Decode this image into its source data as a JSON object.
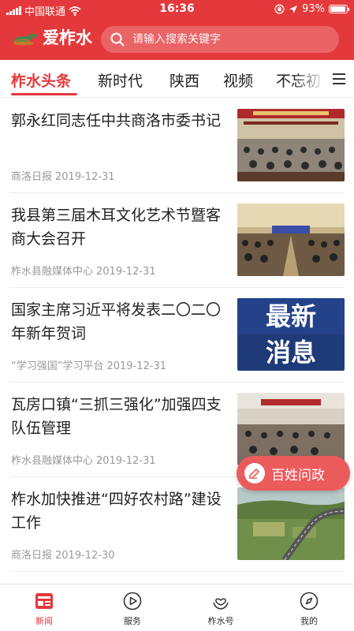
{
  "status_bar": {
    "carrier": "中国联通",
    "time": "16:36",
    "battery": "93%",
    "battery_level": 0.93
  },
  "header": {
    "app_name": "爱柞水",
    "search_placeholder": "请输入搜索关键字"
  },
  "tabs": [
    {
      "label": "柞水头条",
      "active": true
    },
    {
      "label": "新时代"
    },
    {
      "label": "陕西"
    },
    {
      "label": "视频"
    },
    {
      "label": "不忘初"
    }
  ],
  "news": [
    {
      "title": "郭永红同志任中共商洛市委书记",
      "source": "商洛日报",
      "date": "2019-12-31"
    },
    {
      "title": "我县第三届木耳文化艺术节暨客商大会召开",
      "source": "柞水县融媒体中心",
      "date": "2019-12-31"
    },
    {
      "title": "国家主席习近平将发表二〇二〇年新年贺词",
      "source": "“学习强国”学习平台",
      "date": "2019-12-31",
      "image_text_1": "最新",
      "image_text_2": "消息"
    },
    {
      "title": "瓦房口镇“三抓三强化”加强四支队伍管理",
      "source": "柞水县融媒体中心",
      "date": "2019-12-31"
    },
    {
      "title": "柞水加快推进“四好农村路”建设工作",
      "source": "商洛日报",
      "date": "2019-12-30"
    }
  ],
  "float_button": {
    "label": "百姓问政"
  },
  "bottom_nav": [
    {
      "label": "新闻",
      "icon": "news-icon",
      "active": true
    },
    {
      "label": "服务",
      "icon": "play-circle-icon"
    },
    {
      "label": "柞水号",
      "icon": "heart-hand-icon"
    },
    {
      "label": "我的",
      "icon": "compass-icon"
    }
  ],
  "colors": {
    "accent": "#e4393c",
    "float_button": "#ec5b5c"
  }
}
